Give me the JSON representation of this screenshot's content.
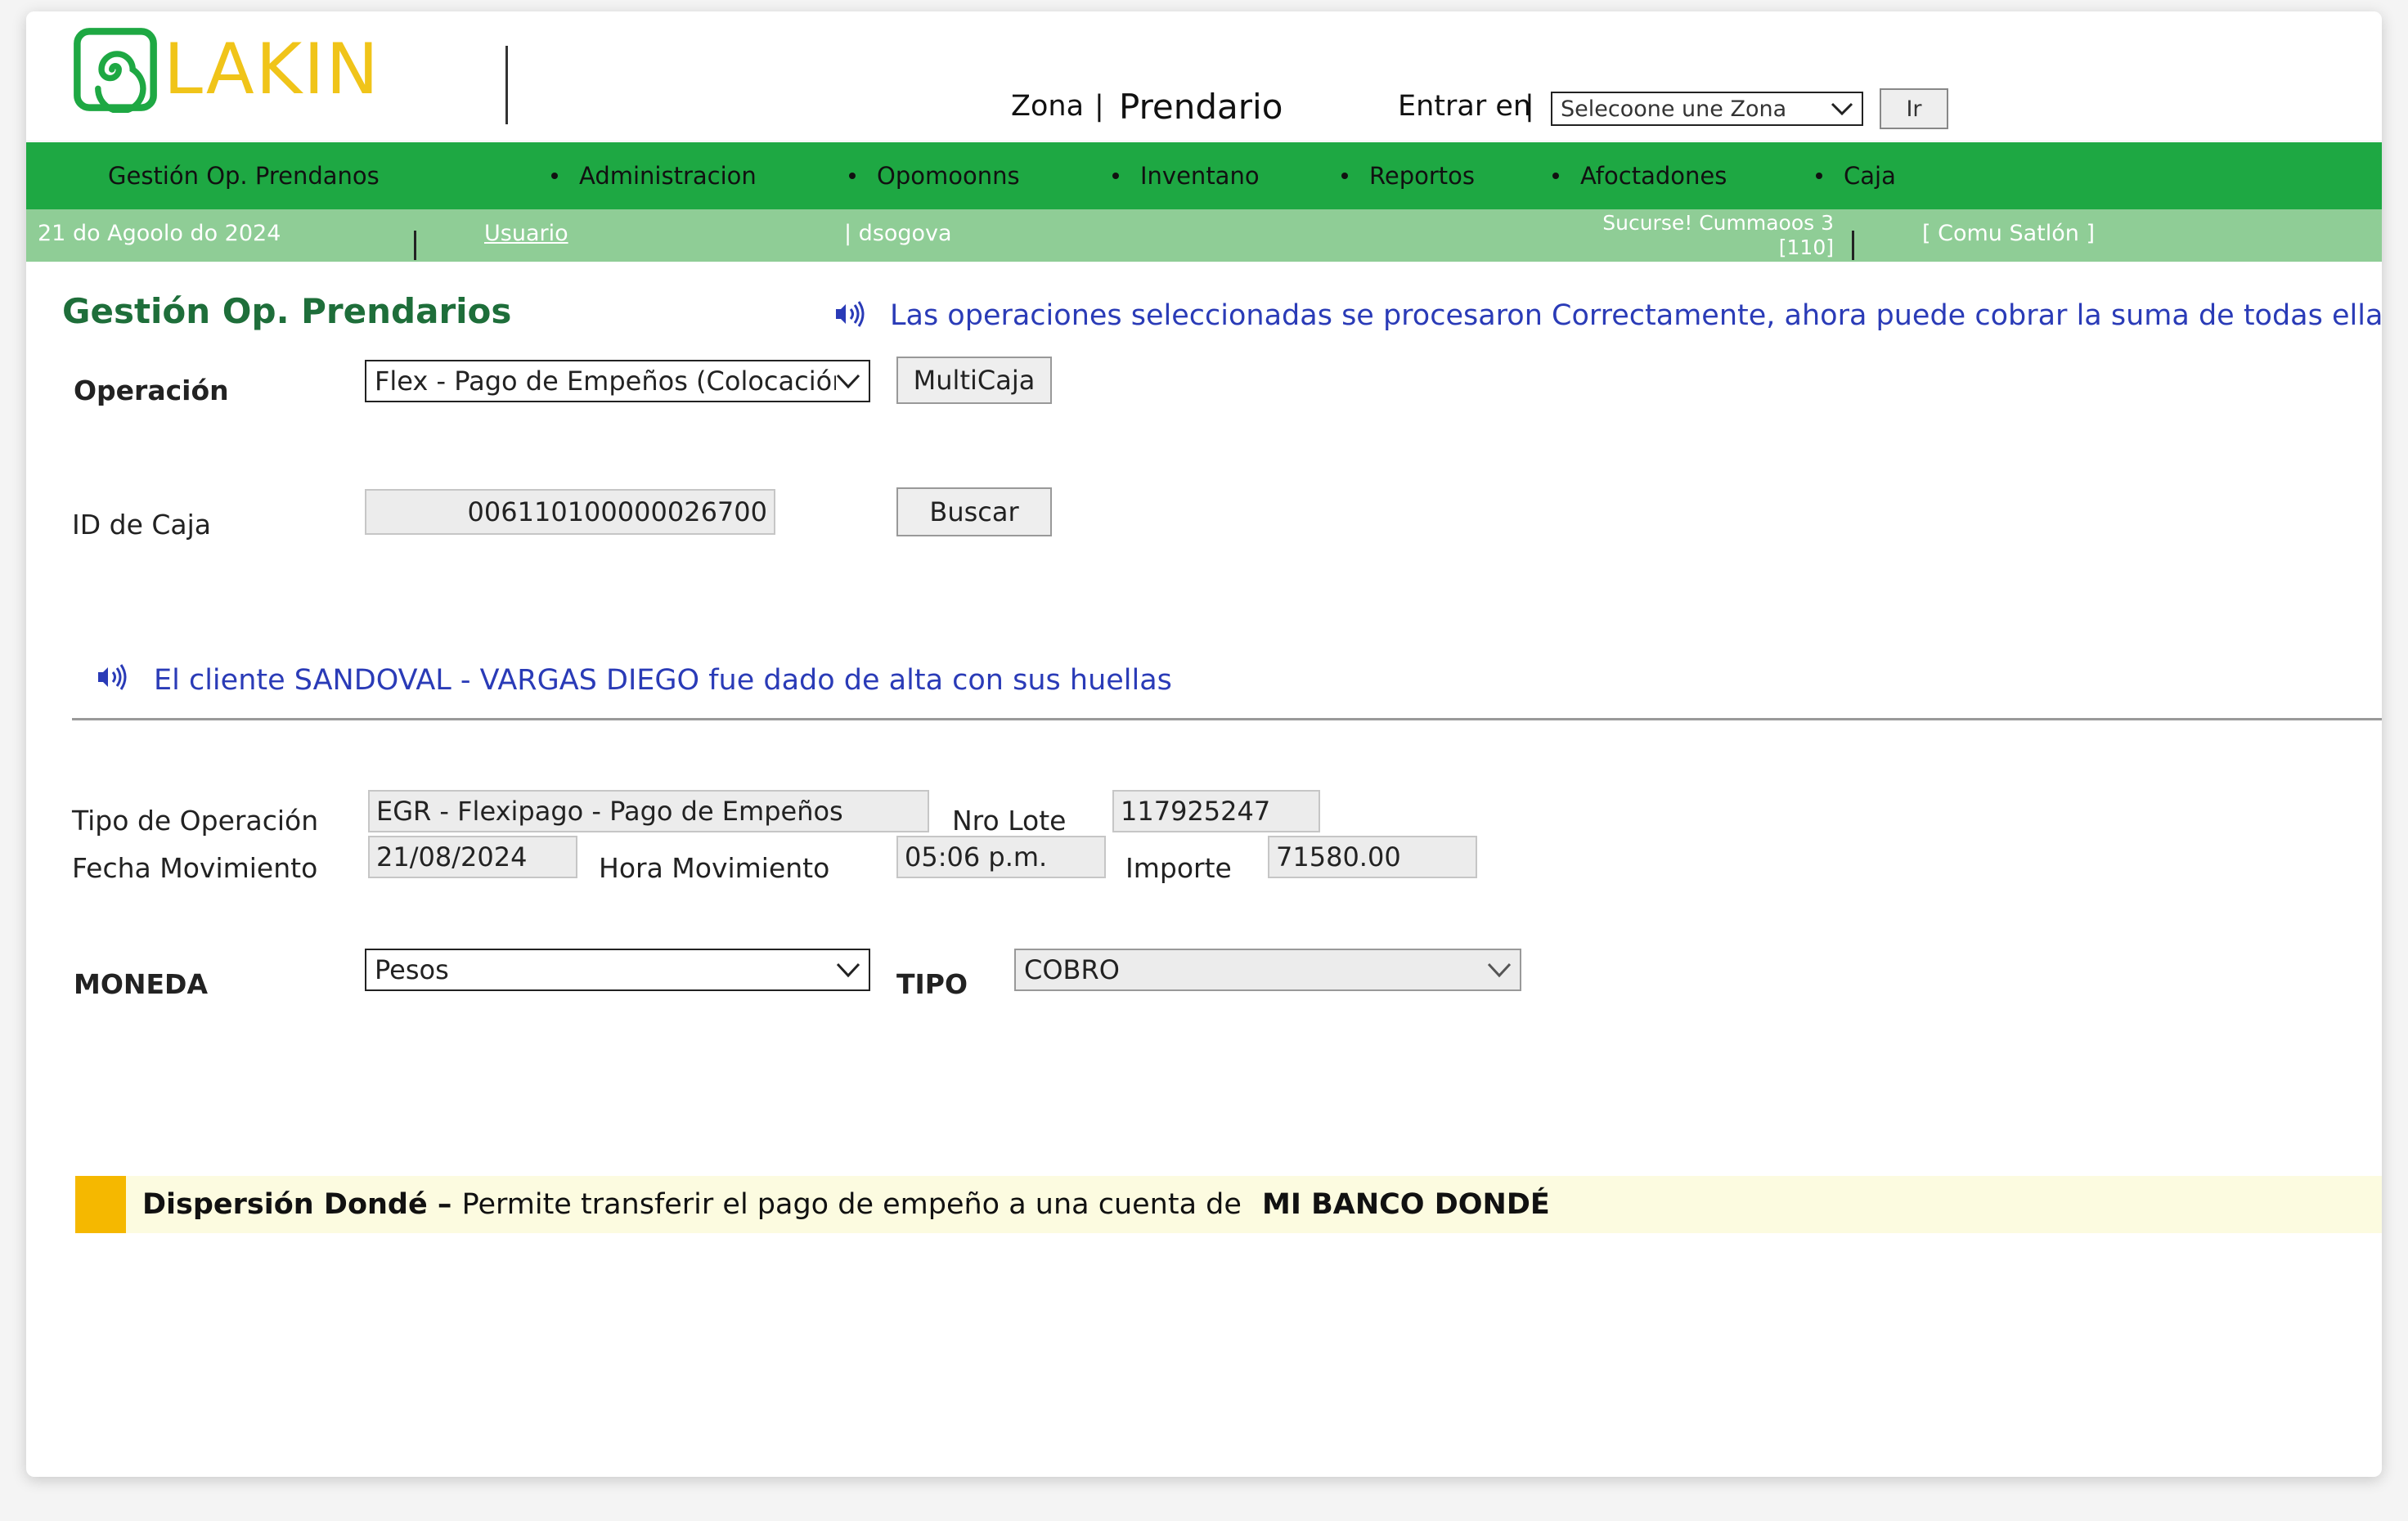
{
  "brand": {
    "name": "LAKIN",
    "colors": {
      "logo_text": "#f0c419",
      "logo_mark": "#1ea843"
    }
  },
  "header": {
    "zona_label": "Zona",
    "zona_pipe": "|",
    "zona_value": "Prendario",
    "entrar_label": "Entrar en",
    "entrar_pipe": "|",
    "zona_select": "Selecoone une Zona",
    "ir_button": "Ir"
  },
  "nav": {
    "items": [
      {
        "label": "Gestión Op. Prendanos"
      },
      {
        "label": "Administracion"
      },
      {
        "label": "Opomoonns"
      },
      {
        "label": "Inventano"
      },
      {
        "label": "Reportos"
      },
      {
        "label": "Afoctadones"
      },
      {
        "label": "Caja"
      }
    ]
  },
  "infobar": {
    "date": "21 do Agoolo do 2024",
    "usuario_link": "Usuario",
    "username": "| dsogova",
    "sucursal_line1": "Sucurse! Cummaoos 3",
    "sucursal_line2": "[110]",
    "logout": "[ Comu Satlón ]"
  },
  "page": {
    "title": "Gestión Op. Prendarios",
    "success_message": "Las operaciones seleccionadas se procesaron Correctamente, ahora puede cobrar la suma de todas ellas",
    "operacion_label": "Operación",
    "operacion_value": "Flex - Pago de Empeños (Colocación)",
    "multicaja_button": "MultiCaja",
    "id_caja_label": "ID de Caja",
    "id_caja_value": "006110100000026700",
    "buscar_button": "Buscar",
    "client_message": "El cliente SANDOVAL - VARGAS DIEGO fue dado de alta con sus huellas"
  },
  "detail": {
    "tipo_operacion_label": "Tipo de Operación",
    "tipo_operacion_value": "EGR - Flexipago - Pago de Empeños",
    "nro_lote_label": "Nro Lote",
    "nro_lote_value": "117925247",
    "fecha_label": "Fecha Movimiento",
    "fecha_value": "21/08/2024",
    "hora_label": "Hora Movimiento",
    "hora_value": "05:06 p.m.",
    "importe_label": "Importe",
    "importe_value": "71580.00",
    "moneda_label": "MONEDA",
    "moneda_value": "Pesos",
    "tipo_label": "TIPO",
    "tipo_value": "COBRO"
  },
  "banner": {
    "title": "Dispersión Dondé",
    "dash": " – ",
    "text": "Permite transferir el pago de empeño a una cuenta de ",
    "bank": "MI BANCO DONDÉ",
    "accent": "#f5b800"
  },
  "icons": {
    "message": "sound-wave-icon",
    "dropdown": "chevron-down-icon"
  }
}
